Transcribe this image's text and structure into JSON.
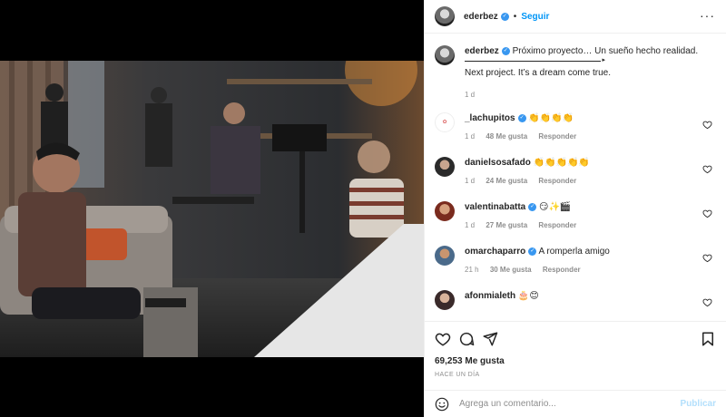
{
  "post": {
    "username": "ederbez",
    "follow_label": "Seguir",
    "more_icon": "more-horizontal-icon",
    "caption_line1": "Próximo proyecto… Un sueño hecho realidad.",
    "caption_line2": "Next project. It’s a dream come true.",
    "caption_time": "1 d"
  },
  "comments": [
    {
      "username": "_lachupitos",
      "verified": true,
      "text": "👏👏👏👏",
      "time": "1 d",
      "likes": "48 Me gusta",
      "reply": "Responder"
    },
    {
      "username": "danielsosafado",
      "verified": false,
      "text": "👏👏👏👏👏",
      "time": "1 d",
      "likes": "24 Me gusta",
      "reply": "Responder"
    },
    {
      "username": "valentinabatta",
      "verified": true,
      "text": "😏✨🎬",
      "time": "1 d",
      "likes": "27 Me gusta",
      "reply": "Responder"
    },
    {
      "username": "omarchaparro",
      "verified": true,
      "text": "A romperla amigo",
      "time": "21 h",
      "likes": "30 Me gusta",
      "reply": "Responder"
    },
    {
      "username": "afonmialeth",
      "verified": false,
      "text": "🎂😊",
      "time": "",
      "likes": "",
      "reply": ""
    }
  ],
  "actions": {
    "likes": "69,253 Me gusta",
    "time_ago": "HACE UN DÍA"
  },
  "add_comment": {
    "placeholder": "Agrega un comentario...",
    "publish": "Publicar"
  },
  "colors": {
    "accent": "#0095f6",
    "verified": "#3897f0",
    "muted": "#8e8e8e",
    "publish_disabled": "#b2dffc"
  }
}
